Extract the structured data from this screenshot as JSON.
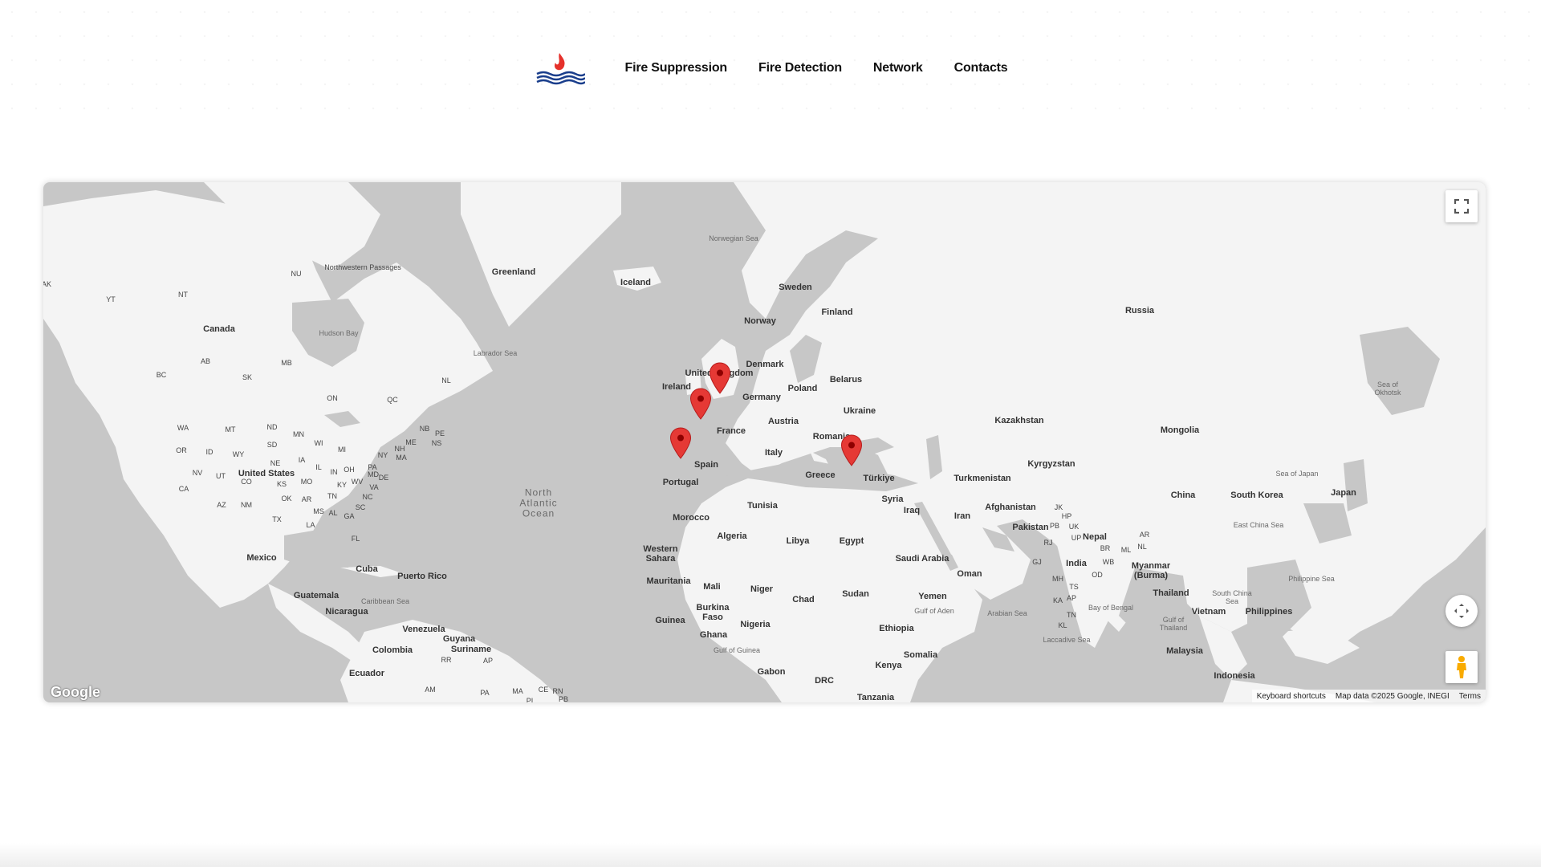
{
  "nav": {
    "items": [
      {
        "label": "Fire Suppression"
      },
      {
        "label": "Fire Detection"
      },
      {
        "label": "Network"
      },
      {
        "label": "Contacts"
      }
    ]
  },
  "logo": {
    "icon": "flame-waves-logo",
    "flame_color": "#e5312b",
    "wave_color": "#1a3e8c"
  },
  "map": {
    "water_color": "#c7c7c7",
    "land_color": "#f4f4f4",
    "marker_color": "#e53935",
    "labels": {
      "greenland": "Greenland",
      "iceland": "Iceland",
      "norwegian_sea": "Norwegian Sea",
      "labrador_sea": "Labrador Sea",
      "north_atlantic": "North Atlantic Ocean",
      "canada": "Canada",
      "united_states": "United States",
      "mexico": "Mexico",
      "cuba": "Cuba",
      "puerto_rico": "Puerto Rico",
      "guatemala": "Guatemala",
      "nicaragua": "Nicaragua",
      "caribbean_sea": "Caribbean Sea",
      "venezuela": "Venezuela",
      "guyana": "Guyana",
      "suriname": "Suriname",
      "colombia": "Colombia",
      "ecuador": "Ecuador",
      "hudson_bay": "Hudson Bay",
      "northwestern_passages": "Northwestern Passages",
      "sweden": "Sweden",
      "finland": "Finland",
      "norway": "Norway",
      "russia": "Russia",
      "united_kingdom": "United Kingdom",
      "ireland": "Ireland",
      "denmark": "Denmark",
      "belarus": "Belarus",
      "poland": "Poland",
      "germany": "Germany",
      "ukraine": "Ukraine",
      "austria": "Austria",
      "france": "France",
      "romania": "Romania",
      "italy": "Italy",
      "spain": "Spain",
      "portugal": "Portugal",
      "greece": "Greece",
      "turkiye": "Türkiye",
      "syria": "Syria",
      "iraq": "Iraq",
      "iran": "Iran",
      "tunisia": "Tunisia",
      "morocco": "Morocco",
      "algeria": "Algeria",
      "libya": "Libya",
      "egypt": "Egypt",
      "western_sahara": "Western Sahara",
      "mauritania": "Mauritania",
      "mali": "Mali",
      "niger": "Niger",
      "chad": "Chad",
      "sudan": "Sudan",
      "burkina_faso": "Burkina Faso",
      "guinea": "Guinea",
      "nigeria": "Nigeria",
      "ghana": "Ghana",
      "gulf_of_guinea": "Gulf of Guinea",
      "gabon": "Gabon",
      "drc": "DRC",
      "ethiopia": "Ethiopia",
      "somalia": "Somalia",
      "kenya": "Kenya",
      "tanzania": "Tanzania",
      "saudi_arabia": "Saudi Arabia",
      "yemen": "Yemen",
      "oman": "Oman",
      "gulf_of_aden": "Gulf of Aden",
      "arabian_sea": "Arabian Sea",
      "kazakhstan": "Kazakhstan",
      "mongolia": "Mongolia",
      "kyrgyzstan": "Kyrgyzstan",
      "turkmenistan": "Turkmenistan",
      "afghanistan": "Afghanistan",
      "pakistan": "Pakistan",
      "nepal": "Nepal",
      "india": "India",
      "china": "China",
      "myanmar": "Myanmar (Burma)",
      "thailand": "Thailand",
      "vietnam": "Vietnam",
      "philippines": "Philippines",
      "malaysia": "Malaysia",
      "indonesia": "Indonesia",
      "south_korea": "South Korea",
      "japan": "Japan",
      "sea_of_japan": "Sea of Japan",
      "sea_of_okhotsk": "Sea of Okhotsk",
      "east_china_sea": "East China Sea",
      "philippine_sea": "Philippine Sea",
      "south_china_sea": "South China Sea",
      "bay_of_bengal": "Bay of Bengal",
      "gulf_of_thailand": "Gulf of Thailand",
      "laccadive_sea": "Laccadive Sea"
    },
    "state_codes": {
      "yt": "YT",
      "nt": "NT",
      "nu": "NU",
      "bc": "BC",
      "ab": "AB",
      "sk": "SK",
      "mb": "MB",
      "on": "ON",
      "qc": "QC",
      "nl": "NL",
      "nb": "NB",
      "pe": "PE",
      "ns": "NS",
      "wa": "WA",
      "mt": "MT",
      "nd": "ND",
      "mn": "MN",
      "or": "OR",
      "id": "ID",
      "wy": "WY",
      "sd": "SD",
      "wi": "WI",
      "mi": "MI",
      "ny": "NY",
      "nh": "NH",
      "me": "ME",
      "ma": "MA",
      "nv": "NV",
      "ut": "UT",
      "ne": "NE",
      "ia": "IA",
      "il": "IL",
      "in": "IN",
      "oh": "OH",
      "pa": "PA",
      "md": "MD",
      "de": "DE",
      "ca": "CA",
      "co": "CO",
      "ks": "KS",
      "mo": "MO",
      "ky": "KY",
      "wv": "WV",
      "va": "VA",
      "az": "AZ",
      "nm": "NM",
      "ok": "OK",
      "ar": "AR",
      "tn": "TN",
      "nc": "NC",
      "tx": "TX",
      "ms": "MS",
      "al": "AL",
      "ga": "GA",
      "sc": "SC",
      "la": "LA",
      "fl": "FL",
      "ak": "AK",
      "rr": "RR",
      "ap": "AP",
      "am": "AM",
      "pa_br": "PA",
      "ma_br": "MA",
      "ce": "CE",
      "rn": "RN",
      "pb_br": "PB",
      "pi": "PI",
      "jk": "JK",
      "hp": "HP",
      "pb": "PB",
      "uk": "UK",
      "rj": "RJ",
      "up": "UP",
      "br": "BR",
      "ml": "ML",
      "ar_in": "AR",
      "nl_in": "NL",
      "gj": "GJ",
      "wb": "WB",
      "mh": "MH",
      "od": "OD",
      "ts": "TS",
      "ka": "KA",
      "ap_in": "AP",
      "tn_in": "TN",
      "kl": "KL"
    },
    "markers": [
      {
        "name": "United Kingdom"
      },
      {
        "name": "France"
      },
      {
        "name": "Portugal"
      },
      {
        "name": "Türkiye"
      }
    ],
    "controls": {
      "fullscreen_icon": "fullscreen-icon",
      "camera_icon": "camera-control-icon",
      "pegman_icon": "pegman-icon"
    },
    "attribution": {
      "logo_text": "Google",
      "keyboard": "Keyboard shortcuts",
      "data": "Map data ©2025 Google, INEGI",
      "terms": "Terms"
    }
  }
}
